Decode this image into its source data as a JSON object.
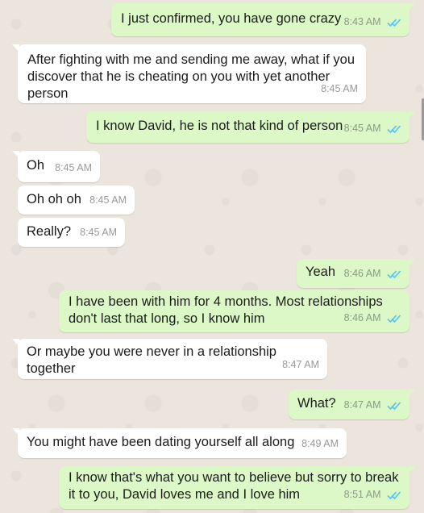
{
  "messages": [
    {
      "direction": "out",
      "text": "I just confirmed, you have gone crazy",
      "time": "8:43 AM",
      "status": "read"
    },
    {
      "direction": "in",
      "text": "After fighting with me and sending me away, what if you discover that he is cheating on you with yet another person",
      "time": "8:45 AM"
    },
    {
      "direction": "out",
      "text": "I know David, he is not that kind of person",
      "time": "8:45 AM",
      "status": "read"
    },
    {
      "direction": "in",
      "text": "Oh",
      "time": "8:45 AM"
    },
    {
      "direction": "in",
      "text": "Oh oh oh",
      "time": "8:45 AM"
    },
    {
      "direction": "in",
      "text": "Really?",
      "time": "8:45 AM"
    },
    {
      "direction": "out",
      "text": "Yeah",
      "time": "8:46 AM",
      "status": "read"
    },
    {
      "direction": "out",
      "text": "I have been with him for 4 months. Most relationships don't last that long, so I know him",
      "time": "8:46 AM",
      "status": "read"
    },
    {
      "direction": "in",
      "text": "Or maybe you were never in a relationship together",
      "time": "8:47 AM"
    },
    {
      "direction": "out",
      "text": "What?",
      "time": "8:47 AM",
      "status": "read"
    },
    {
      "direction": "in",
      "text": "You might have been dating yourself all along",
      "time": "8:49 AM"
    },
    {
      "direction": "out",
      "text": "I know that's what you want to believe but sorry to break it to you, David loves me and I love him",
      "time": "8:51 AM",
      "status": "read"
    }
  ],
  "colors": {
    "outgoing_bubble": "#dcf8c6",
    "incoming_bubble": "#ffffff",
    "read_ticks": "#4fc3f7",
    "wallpaper": "#ece5dd"
  },
  "icons": {
    "read_status": "double-check-icon"
  }
}
